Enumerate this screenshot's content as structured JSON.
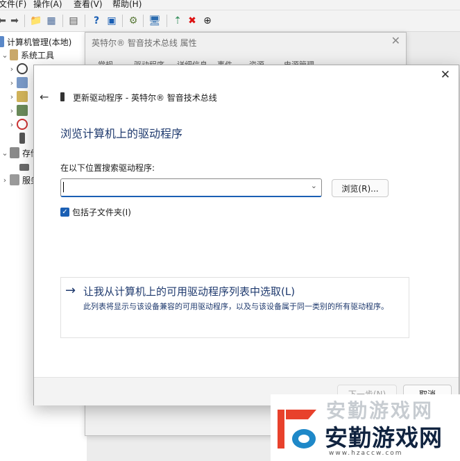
{
  "menubar": {
    "items": [
      "文件(F)",
      "操作(A)",
      "查看(V)",
      "帮助(H)"
    ]
  },
  "toolbar": {
    "icons": [
      "back-arrow-icon",
      "forward-arrow-icon",
      "up-folder-icon",
      "show-hide-tree-icon",
      "properties-icon",
      "help-icon",
      "help-topics-icon",
      "scan-hardware-icon",
      "computer-icon",
      "update-driver-icon",
      "uninstall-icon",
      "disable-icon"
    ]
  },
  "tree": {
    "root": "计算机管理(本地)",
    "system_tools": "系统工具",
    "storage": "存储",
    "services": "服务和"
  },
  "properties_dialog": {
    "title": "英特尔® 智音技术总线 属性",
    "tabs": [
      "常规",
      "驱动程序",
      "详细信息",
      "事件",
      "资源",
      "电源管理"
    ]
  },
  "wizard": {
    "header": "更新驱动程序 - 英特尔® 智音技术总线",
    "title": "浏览计算机上的驱动程序",
    "search_label": "在以下位置搜索驱动程序:",
    "path_value": "",
    "browse_label": "浏览(R)...",
    "include_subfolders_label": "包括子文件夹(I)",
    "include_subfolders_checked": true,
    "pick_title": "让我从计算机上的可用驱动程序列表中选取(L)",
    "pick_description": "此列表将显示与该设备兼容的可用驱动程序，以及与该设备属于同一类别的所有驱动程序。",
    "next_label": "下一步(N)",
    "cancel_label": "取消"
  },
  "watermark": {
    "top_text": "安勤游戏网",
    "main_text": "安勤游戏网",
    "url": "www.hzaccw.com"
  },
  "colors": {
    "accent": "#1a5fb4",
    "link_blue": "#1f3a6e",
    "footer_bg": "#f3f3f3"
  }
}
